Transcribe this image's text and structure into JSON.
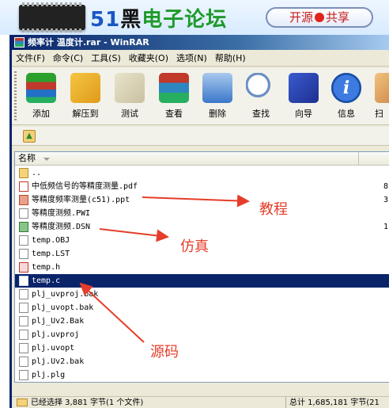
{
  "banner": {
    "logo_51": "51",
    "logo_black": "黑",
    "logo_rest": "电子论坛",
    "slogan_left": "开源",
    "slogan_right": "共享"
  },
  "window": {
    "title": "频率计 温度计.rar - WinRAR"
  },
  "menu": [
    {
      "label": "文件(F)"
    },
    {
      "label": "命令(C)"
    },
    {
      "label": "工具(S)"
    },
    {
      "label": "收藏夹(O)"
    },
    {
      "label": "选项(N)"
    },
    {
      "label": "帮助(H)"
    }
  ],
  "toolbar": [
    {
      "label": "添加",
      "icon": "add-icon"
    },
    {
      "label": "解压到",
      "icon": "extract-icon"
    },
    {
      "label": "测试",
      "icon": "test-icon"
    },
    {
      "label": "查看",
      "icon": "view-icon"
    },
    {
      "label": "删除",
      "icon": "delete-icon"
    },
    {
      "label": "查找",
      "icon": "find-icon"
    },
    {
      "label": "向导",
      "icon": "wizard-icon"
    },
    {
      "label": "信息",
      "icon": "info-icon",
      "glyph": "i"
    },
    {
      "label": "扫",
      "icon": "scan-icon"
    }
  ],
  "filelist": {
    "column_name": "名称",
    "files": [
      {
        "name": "..",
        "type": "folder",
        "size": ""
      },
      {
        "name": "中低频信号的等精度测量.pdf",
        "type": "pdf",
        "size": "8"
      },
      {
        "name": "等精度频率测量(c51).ppt",
        "type": "ppt",
        "size": "3"
      },
      {
        "name": "等精度测频.PWI",
        "type": "file",
        "size": ""
      },
      {
        "name": "等精度测频.DSN",
        "type": "dsn",
        "size": "1"
      },
      {
        "name": "temp.OBJ",
        "type": "file",
        "size": ""
      },
      {
        "name": "temp.LST",
        "type": "file",
        "size": ""
      },
      {
        "name": "temp.h",
        "type": "h",
        "size": ""
      },
      {
        "name": "temp.c",
        "type": "file",
        "size": "",
        "selected": true
      },
      {
        "name": "plj_uvproj.bak",
        "type": "file",
        "size": ""
      },
      {
        "name": "plj_uvopt.bak",
        "type": "file",
        "size": ""
      },
      {
        "name": "plj_Uv2.Bak",
        "type": "file",
        "size": ""
      },
      {
        "name": "plj.uvproj",
        "type": "file",
        "size": ""
      },
      {
        "name": "plj.uvopt",
        "type": "file",
        "size": ""
      },
      {
        "name": "plj.Uv2.bak",
        "type": "file",
        "size": ""
      },
      {
        "name": "plj.plg",
        "type": "file",
        "size": ""
      }
    ]
  },
  "status": {
    "left": "已经选择 3,881 字节(1 个文件)",
    "right": "总计 1,685,181 字节(21"
  },
  "annotations": {
    "tutorial": "教程",
    "simulation": "仿真",
    "source": "源码",
    "color": "#e53d2a"
  }
}
